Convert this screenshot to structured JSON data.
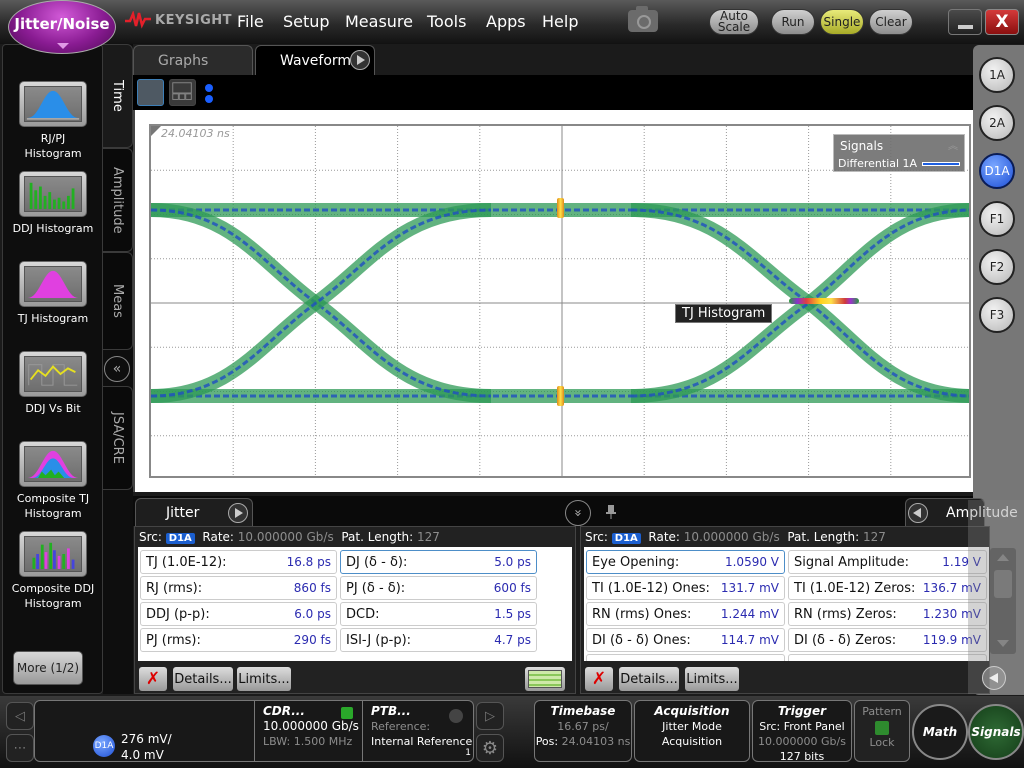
{
  "app": {
    "mode_button": "Jitter/Noise",
    "brand": "KEYSIGHT",
    "menus": [
      "File",
      "Setup",
      "Measure",
      "Tools",
      "Apps",
      "Help"
    ],
    "buttons": {
      "auto_scale_line1": "Auto",
      "auto_scale_line2": "Scale",
      "run": "Run",
      "single": "Single",
      "clear": "Clear",
      "close": "X"
    }
  },
  "left_panel": {
    "tools": [
      {
        "label": "RJ/PJ Histogram",
        "icon": "rjpj-histogram-icon"
      },
      {
        "label": "DDJ Histogram",
        "icon": "ddj-histogram-icon"
      },
      {
        "label": "TJ Histogram",
        "icon": "tj-histogram-icon"
      },
      {
        "label": "DDJ Vs Bit",
        "icon": "ddj-vs-bit-icon"
      },
      {
        "label": "Composite TJ Histogram",
        "icon": "composite-tj-histogram-icon"
      },
      {
        "label": "Composite DDJ Histogram",
        "icon": "composite-ddj-histogram-icon"
      }
    ],
    "more_button": "More (1/2)",
    "vertical_tabs": [
      "Time",
      "Amplitude",
      "Meas",
      "JSA/CRE"
    ],
    "active_tab": "Time"
  },
  "waveform": {
    "tabs": [
      "Graphs",
      "Waveform"
    ],
    "active_tab": "Waveform",
    "timestamp": "24.04103 ns",
    "legend_title": "Signals",
    "legend_signal": "Differential 1A",
    "legend_color": "#1e5fe0",
    "overlay_label": "TJ Histogram"
  },
  "channels": [
    "1A",
    "2A",
    "D1A",
    "F1",
    "F2",
    "F3"
  ],
  "active_channel": "D1A",
  "jitter": {
    "tab_label": "Jitter",
    "src_label": "Src:",
    "src": "D1A",
    "rate_label": "Rate:",
    "rate": "10.000000 Gb/s",
    "pat_label": "Pat. Length:",
    "pat": "127",
    "cells": [
      {
        "name": "TJ (1.0E-12):",
        "value": "16.8 ps"
      },
      {
        "name": "DJ (δ - δ):",
        "value": "5.0 ps"
      },
      {
        "name": "RJ (rms):",
        "value": "860 fs"
      },
      {
        "name": "PJ (δ - δ):",
        "value": "600 fs"
      },
      {
        "name": "DDJ (p-p):",
        "value": "6.0 ps"
      },
      {
        "name": "DCD:",
        "value": "1.5 ps"
      },
      {
        "name": "PJ (rms):",
        "value": "290 fs"
      },
      {
        "name": "ISI-J (p-p):",
        "value": "4.7 ps"
      }
    ],
    "details": "Details...",
    "limits": "Limits..."
  },
  "amplitude": {
    "tab_label": "Amplitude",
    "src_label": "Src:",
    "src": "D1A",
    "rate_label": "Rate:",
    "rate": "10.000000 Gb/s",
    "pat_label": "Pat. Length:",
    "pat": "127",
    "cells": [
      {
        "name": "Eye Opening:",
        "value": "1.0590 V"
      },
      {
        "name": "Signal Amplitude:",
        "value": "1.19 V"
      },
      {
        "name": "TI (1.0E-12) Ones:",
        "value": "131.7 mV"
      },
      {
        "name": "TI (1.0E-12) Zeros:",
        "value": "136.7 mV"
      },
      {
        "name": "RN (rms) Ones:",
        "value": "1.244 mV"
      },
      {
        "name": "RN (rms) Zeros:",
        "value": "1.230 mV"
      },
      {
        "name": "DI (δ - δ) Ones:",
        "value": "114.7 mV"
      },
      {
        "name": "DI (δ - δ) Zeros:",
        "value": "119.9 mV"
      }
    ],
    "details": "Details...",
    "limits": "Limits..."
  },
  "status": {
    "channel_badge": "D1A",
    "scale": "276 mV/",
    "offset": "4.0 mV",
    "cdr_title": "CDR...",
    "cdr_rate": "10.000000 Gb/s",
    "cdr_lbw": "LBW: 1.500 MHz",
    "ptb_title": "PTB...",
    "ptb_ref_label": "Reference:",
    "ptb_ref": "Internal Reference",
    "ptb_count": "1",
    "timebase_title": "Timebase",
    "timebase_scale": "16.67 ps/",
    "timebase_pos_label": "Pos:",
    "timebase_pos": "24.04103 ns",
    "acq_title": "Acquisition",
    "acq_line1": "Jitter Mode",
    "acq_line2": "Acquisition",
    "trig_title": "Trigger",
    "trig_src": "Src: Front Panel",
    "trig_rate": "10.000000 Gb/s",
    "trig_bits": "127 bits",
    "pattern_title": "Pattern",
    "pattern_lock": "Lock",
    "math": "Math",
    "signals": "Signals"
  }
}
